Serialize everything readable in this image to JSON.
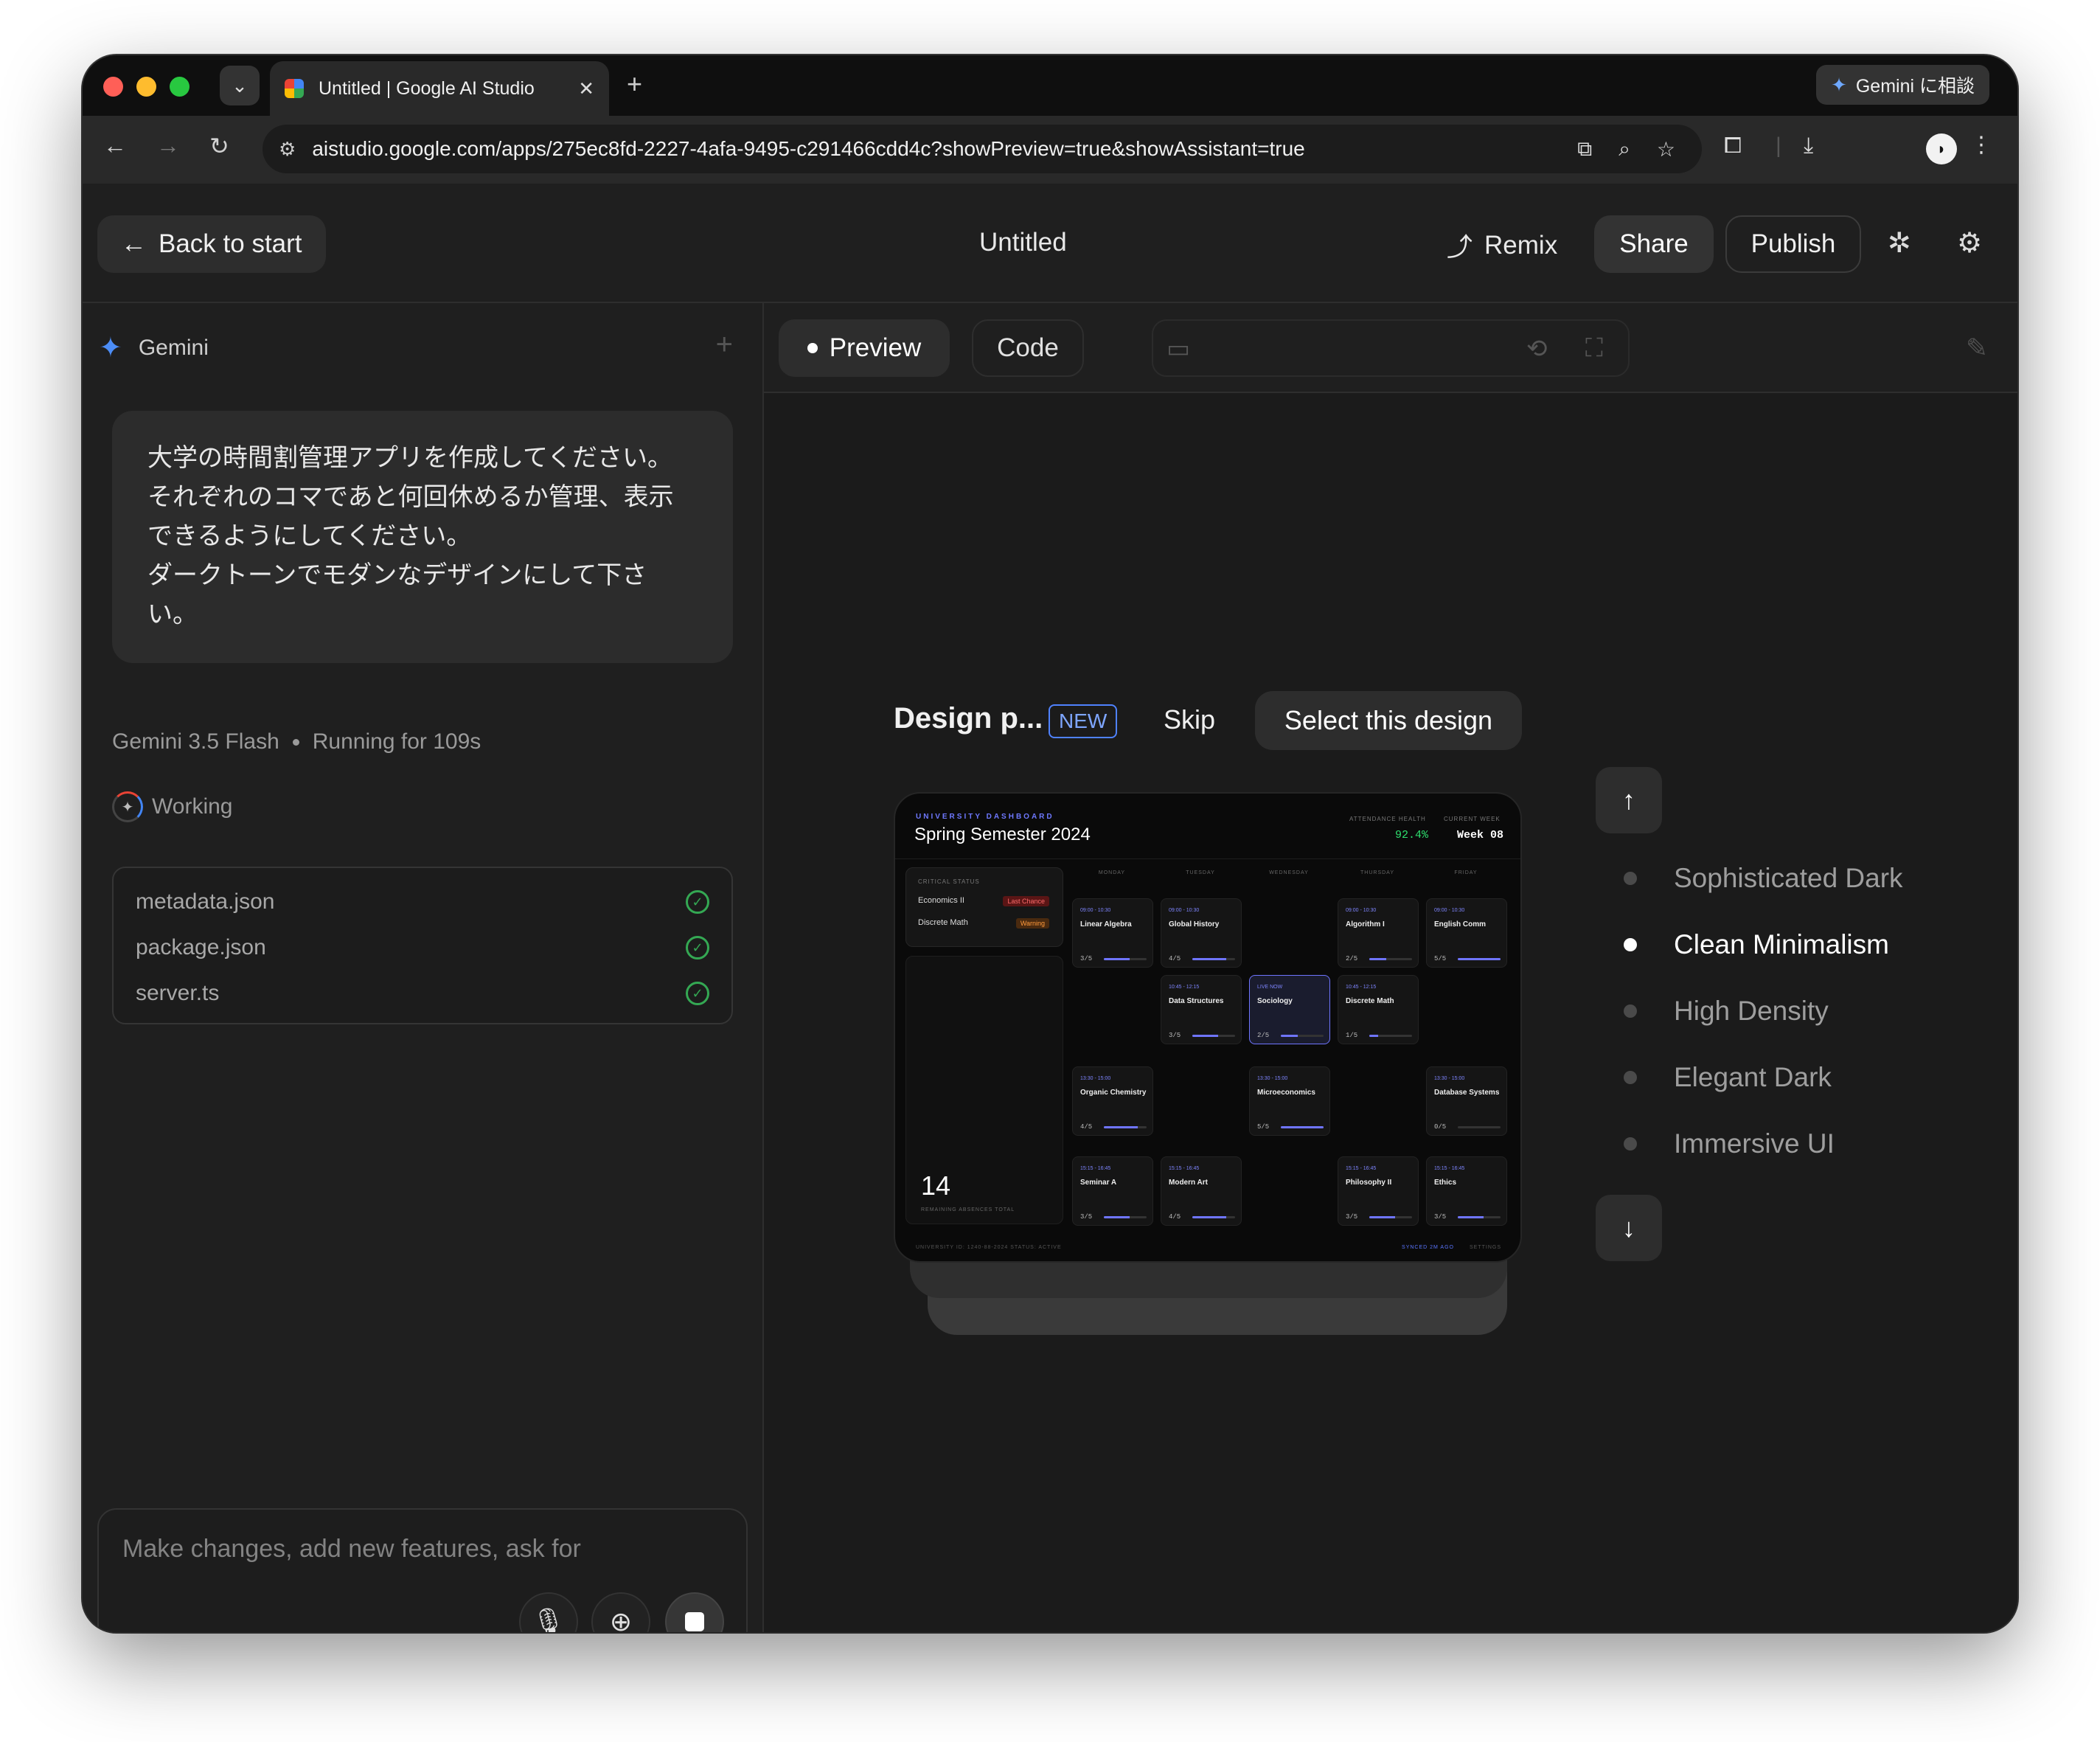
{
  "browser": {
    "tab_title": "Untitled | Google AI Studio",
    "gemini_button": "Gemini に相談",
    "url": "aistudio.google.com/apps/275ec8fd-2227-4afa-9495-c291466cdd4c?showPreview=true&showAssistant=true"
  },
  "header": {
    "back_label": "Back to start",
    "title": "Untitled",
    "remix_label": "Remix",
    "share_label": "Share",
    "publish_label": "Publish"
  },
  "assistant": {
    "label": "Gemini",
    "prompt_lines": [
      "大学の時間割管理アプリを作成してください。",
      "それぞれのコマであと何回休めるか管理、表示",
      "できるようにしてください。",
      "ダークトーンでモダンなデザインにして下さ",
      "い。"
    ],
    "model": "Gemini 3.5 Flash",
    "running": "Running for 109s",
    "working": "Working",
    "files": [
      {
        "name": "metadata.json",
        "status": "done"
      },
      {
        "name": "package.json",
        "status": "done"
      },
      {
        "name": "server.ts",
        "status": "done"
      }
    ],
    "input_placeholder": "Make changes, add new features, ask for"
  },
  "preview": {
    "tabs": {
      "preview": "Preview",
      "code": "Code"
    }
  },
  "design_picker": {
    "title": "Design p...",
    "badge": "NEW",
    "skip_label": "Skip",
    "select_label": "Select this design",
    "options": [
      {
        "label": "Sophisticated Dark",
        "active": false
      },
      {
        "label": "Clean Minimalism",
        "active": true
      },
      {
        "label": "High Density",
        "active": false
      },
      {
        "label": "Elegant Dark",
        "active": false
      },
      {
        "label": "Immersive UI",
        "active": false
      }
    ]
  },
  "thumbnail": {
    "eyebrow": "UNIVERSITY DASHBOARD",
    "title": "Spring Semester 2024",
    "health_label": "ATTENDANCE HEALTH",
    "health_value": "92.4%",
    "week_label": "CURRENT WEEK",
    "week_value": "Week 08",
    "critical_label": "CRITICAL STATUS",
    "critical": [
      {
        "name": "Economics II",
        "tag": "Last Chance"
      },
      {
        "name": "Discrete Math",
        "tag": "Warning"
      }
    ],
    "remaining_total": "14",
    "remaining_label": "REMAINING ABSENCES TOTAL",
    "days": [
      "MONDAY",
      "TUESDAY",
      "WEDNESDAY",
      "THURSDAY",
      "FRIDAY"
    ],
    "classes": [
      {
        "day": 0,
        "row": 0,
        "time": "09:00 - 10:30",
        "name": "Linear Algebra",
        "rem": "3/5",
        "fill": 0.6,
        "live": false
      },
      {
        "day": 1,
        "row": 0,
        "time": "09:00 - 10:30",
        "name": "Global History",
        "rem": "4/5",
        "fill": 0.8,
        "live": false
      },
      {
        "day": 3,
        "row": 0,
        "time": "09:00 - 10:30",
        "name": "Algorithm I",
        "rem": "2/5",
        "fill": 0.4,
        "live": false
      },
      {
        "day": 4,
        "row": 0,
        "time": "09:00 - 10:30",
        "name": "English Comm",
        "rem": "5/5",
        "fill": 1.0,
        "live": false
      },
      {
        "day": 1,
        "row": 1,
        "time": "10:45 - 12:15",
        "name": "Data Structures",
        "rem": "3/5",
        "fill": 0.6,
        "live": false
      },
      {
        "day": 2,
        "row": 1,
        "time": "LIVE NOW",
        "name": "Sociology",
        "rem": "2/5",
        "fill": 0.4,
        "live": true
      },
      {
        "day": 3,
        "row": 1,
        "time": "10:45 - 12:15",
        "name": "Discrete Math",
        "rem": "1/5",
        "fill": 0.2,
        "live": false
      },
      {
        "day": 0,
        "row": 2,
        "time": "13:30 - 15:00",
        "name": "Organic Chemistry",
        "rem": "4/5",
        "fill": 0.8,
        "live": false
      },
      {
        "day": 2,
        "row": 2,
        "time": "13:30 - 15:00",
        "name": "Microeconomics",
        "rem": "5/5",
        "fill": 1.0,
        "live": false
      },
      {
        "day": 4,
        "row": 2,
        "time": "13:30 - 15:00",
        "name": "Database Systems",
        "rem": "0/5",
        "fill": 0.0,
        "live": false
      },
      {
        "day": 0,
        "row": 3,
        "time": "15:15 - 16:45",
        "name": "Seminar A",
        "rem": "3/5",
        "fill": 0.6,
        "live": false
      },
      {
        "day": 1,
        "row": 3,
        "time": "15:15 - 16:45",
        "name": "Modern Art",
        "rem": "4/5",
        "fill": 0.8,
        "live": false
      },
      {
        "day": 3,
        "row": 3,
        "time": "15:15 - 16:45",
        "name": "Philosophy II",
        "rem": "3/5",
        "fill": 0.6,
        "live": false
      },
      {
        "day": 4,
        "row": 3,
        "time": "15:15 - 16:45",
        "name": "Ethics",
        "rem": "3/5",
        "fill": 0.6,
        "live": false
      }
    ],
    "footer_left": "UNIVERSITY ID: 1240-88-2024     STATUS: ACTIVE",
    "footer_sync": "SYNCED 2M AGO",
    "footer_settings": "SETTINGS"
  }
}
